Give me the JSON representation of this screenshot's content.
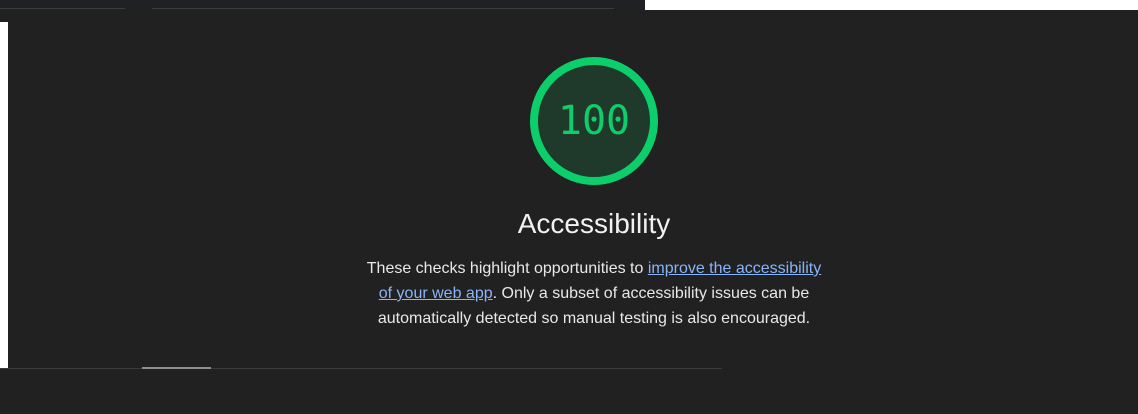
{
  "score": {
    "value": "100",
    "fraction": 1.0,
    "color": "#0cce6b"
  },
  "category": {
    "title": "Accessibility"
  },
  "description": {
    "text_before": "These checks highlight opportunities to ",
    "link_text": "improve the accessibility of your web app",
    "text_after": ". Only a subset of accessibility issues can be automatically detected so manual testing is also encouraged."
  },
  "colors": {
    "background": "#212121",
    "link": "#8ab4f8",
    "pass": "#0cce6b"
  }
}
